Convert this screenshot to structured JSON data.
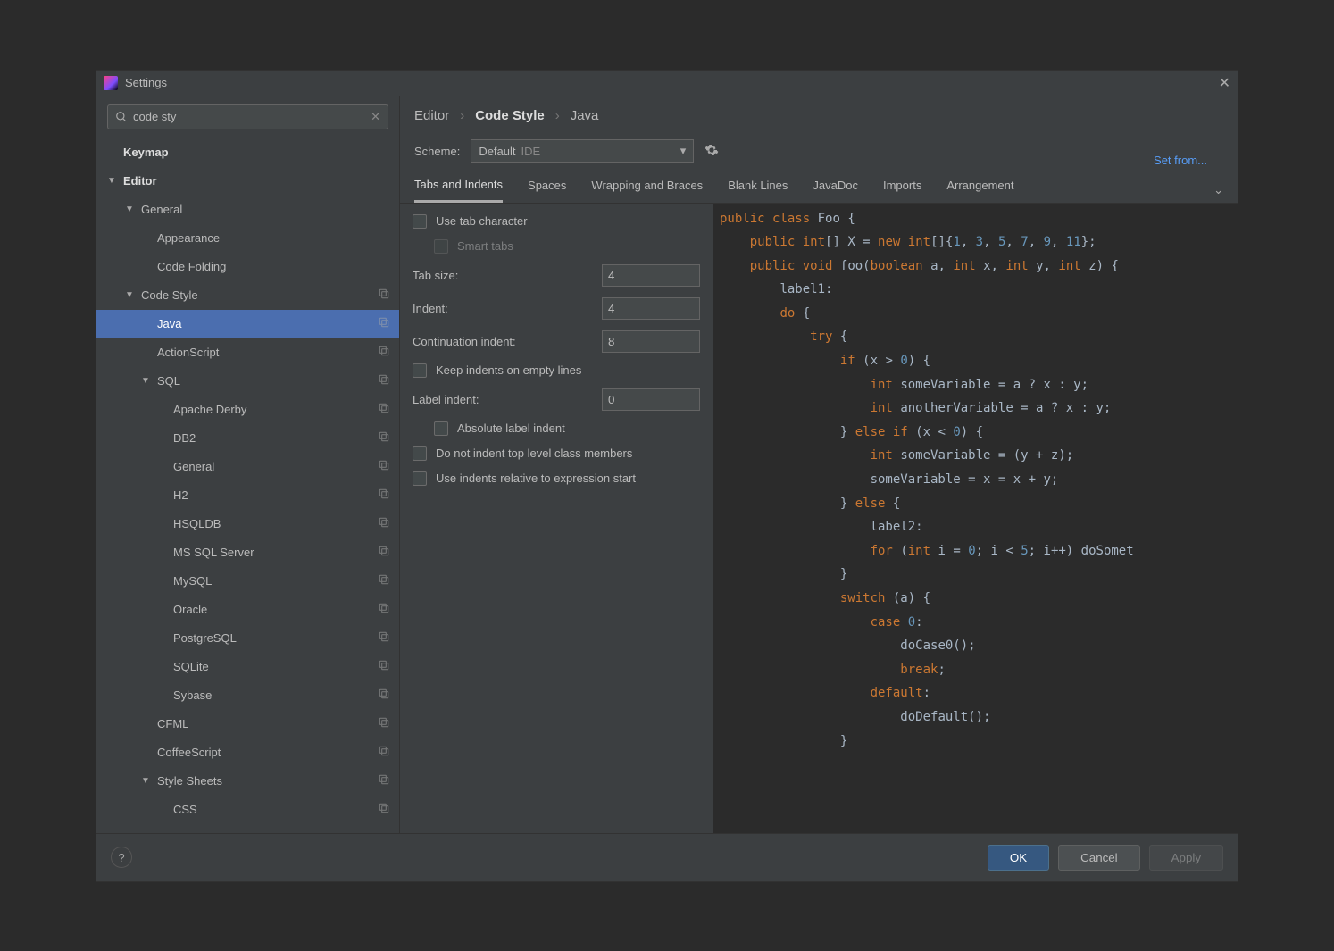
{
  "title": "Settings",
  "search": {
    "value": "code sty"
  },
  "tree": [
    {
      "label": "Keymap",
      "level": 0,
      "arrow": false
    },
    {
      "label": "Editor",
      "level": 0,
      "arrow": true
    },
    {
      "label": "General",
      "level": 1,
      "arrow": true
    },
    {
      "label": "Appearance",
      "level": 2
    },
    {
      "label": "Code Folding",
      "level": 2
    },
    {
      "label": "Code Style",
      "level": 1,
      "arrow": true,
      "copy": true
    },
    {
      "label": "Java",
      "level": 2,
      "selected": true,
      "copy": true
    },
    {
      "label": "ActionScript",
      "level": 2,
      "copy": true
    },
    {
      "label": "SQL",
      "level": 2,
      "arrow": true,
      "copy": true
    },
    {
      "label": "Apache Derby",
      "level": 3,
      "copy": true
    },
    {
      "label": "DB2",
      "level": 3,
      "copy": true
    },
    {
      "label": "General",
      "level": 3,
      "copy": true
    },
    {
      "label": "H2",
      "level": 3,
      "copy": true
    },
    {
      "label": "HSQLDB",
      "level": 3,
      "copy": true
    },
    {
      "label": "MS SQL Server",
      "level": 3,
      "copy": true
    },
    {
      "label": "MySQL",
      "level": 3,
      "copy": true
    },
    {
      "label": "Oracle",
      "level": 3,
      "copy": true
    },
    {
      "label": "PostgreSQL",
      "level": 3,
      "copy": true
    },
    {
      "label": "SQLite",
      "level": 3,
      "copy": true
    },
    {
      "label": "Sybase",
      "level": 3,
      "copy": true
    },
    {
      "label": "CFML",
      "level": 2,
      "copy": true
    },
    {
      "label": "CoffeeScript",
      "level": 2,
      "copy": true
    },
    {
      "label": "Style Sheets",
      "level": 2,
      "arrow": true,
      "copy": true
    },
    {
      "label": "CSS",
      "level": 3,
      "copy": true
    }
  ],
  "breadcrumb": {
    "a": "Editor",
    "b": "Code Style",
    "c": "Java"
  },
  "scheme": {
    "label": "Scheme:",
    "value": "Default",
    "suffix": "IDE"
  },
  "set_from": "Set from...",
  "tabs": [
    "Tabs and Indents",
    "Spaces",
    "Wrapping and Braces",
    "Blank Lines",
    "JavaDoc",
    "Imports",
    "Arrangement"
  ],
  "form": {
    "use_tab": "Use tab character",
    "smart_tabs": "Smart tabs",
    "tab_size_label": "Tab size:",
    "tab_size": "4",
    "indent_label": "Indent:",
    "indent": "4",
    "cont_label": "Continuation indent:",
    "cont": "8",
    "keep_empty": "Keep indents on empty lines",
    "label_indent_label": "Label indent:",
    "label_indent": "0",
    "abs_label": "Absolute label indent",
    "no_top": "Do not indent top level class members",
    "rel_expr": "Use indents relative to expression start"
  },
  "footer": {
    "ok": "OK",
    "cancel": "Cancel",
    "apply": "Apply"
  },
  "code": [
    [
      "kw:public",
      " ",
      "kw:class",
      " ",
      "id:Foo {"
    ],
    [
      "    ",
      "kw:public",
      " ",
      "kw:int",
      "id:[] X = ",
      "kw:new",
      " ",
      "kw:int",
      "id:[]{",
      "num:1",
      "id:, ",
      "num:3",
      "id:, ",
      "num:5",
      "id:, ",
      "num:7",
      "id:, ",
      "num:9",
      "id:, ",
      "num:11",
      "id:};"
    ],
    [
      ""
    ],
    [
      "    ",
      "kw:public",
      " ",
      "kw:void",
      " ",
      "id:foo(",
      "kw:boolean",
      " ",
      "id:a, ",
      "kw:int",
      " ",
      "id:x, ",
      "kw:int",
      " ",
      "id:y, ",
      "kw:int",
      " ",
      "id:z) {"
    ],
    [
      "        ",
      "id:label1:"
    ],
    [
      "        ",
      "kw:do",
      " ",
      "id:{"
    ],
    [
      "            ",
      "kw:try",
      " ",
      "id:{"
    ],
    [
      "                ",
      "kw:if",
      " ",
      "id:(x > ",
      "num:0",
      "id:) {"
    ],
    [
      "                    ",
      "kw:int",
      " ",
      "id:someVariable = a ? x : y;"
    ],
    [
      "                    ",
      "kw:int",
      " ",
      "id:anotherVariable = a ? x : y;"
    ],
    [
      "                ",
      "id:} ",
      "kw:else if",
      " ",
      "id:(x < ",
      "num:0",
      "id:) {"
    ],
    [
      "                    ",
      "kw:int",
      " ",
      "id:someVariable = (y + z);"
    ],
    [
      "                    ",
      "id:someVariable = x = x + y;"
    ],
    [
      "                ",
      "id:} ",
      "kw:else",
      " ",
      "id:{"
    ],
    [
      "                    ",
      "id:label2:"
    ],
    [
      "                    ",
      "kw:for",
      " ",
      "id:(",
      "kw:int",
      " ",
      "id:i = ",
      "num:0",
      "id:; i < ",
      "num:5",
      "id:; i++) doSomet"
    ],
    [
      "                ",
      "id:}"
    ],
    [
      "                ",
      "kw:switch",
      " ",
      "id:(a) {"
    ],
    [
      "                    ",
      "kw:case",
      " ",
      "num:0",
      "id::"
    ],
    [
      "                        ",
      "id:doCase0();"
    ],
    [
      "                        ",
      "kw:break",
      "id:;"
    ],
    [
      "                    ",
      "kw:default",
      "id::"
    ],
    [
      "                        ",
      "id:doDefault();"
    ],
    [
      "                ",
      "id:}"
    ]
  ]
}
